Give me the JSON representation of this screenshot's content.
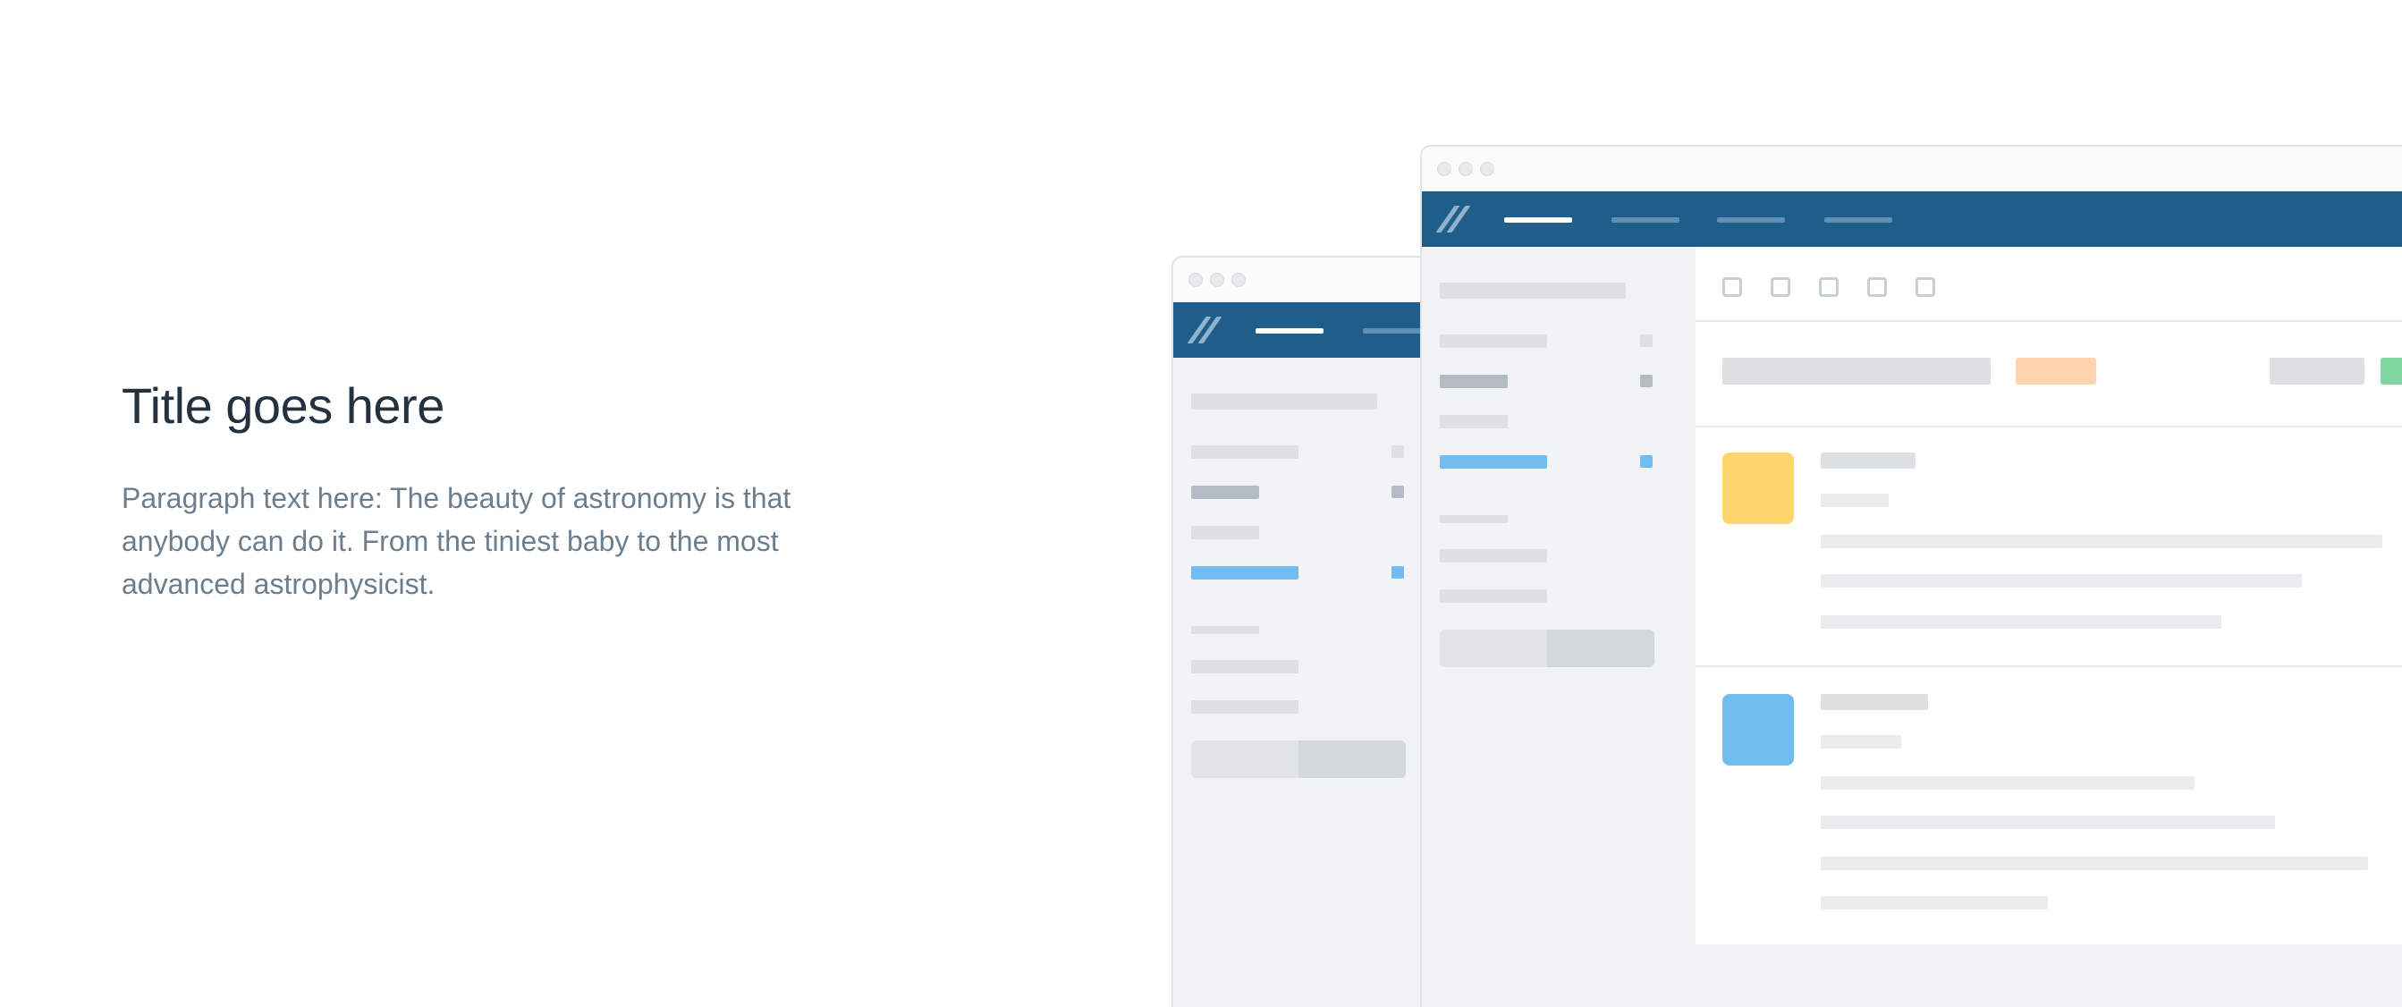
{
  "hero": {
    "title": "Title goes here",
    "paragraph": "Paragraph text here: The beauty of astronomy is that anybody can do it. From the tiniest baby to the most advanced astrophysicist."
  },
  "colors": {
    "nav_blue": "#1f5e8b",
    "accent_blue": "#72bdf0",
    "card_yellow": "#ffd66e",
    "card_blue": "#72bdf0",
    "badge_peach": "#ffd3b0",
    "badge_green": "#7fd6a0",
    "title_text": "#243240",
    "body_text": "#6c7e8d"
  },
  "icons": {
    "app_logo": "slash-logo-icon",
    "window_controls": "window-dot-icon",
    "checkbox": "checkbox-icon"
  }
}
